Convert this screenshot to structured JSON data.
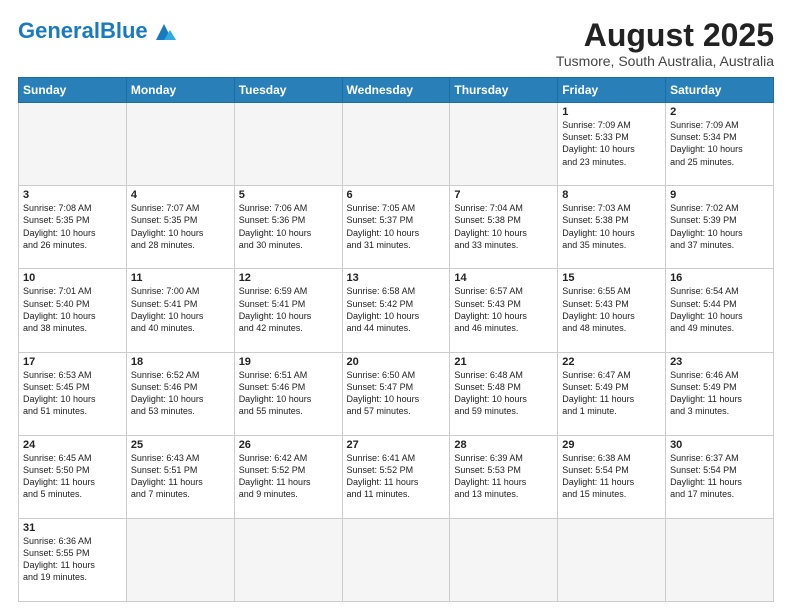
{
  "header": {
    "logo_general": "General",
    "logo_blue": "Blue",
    "month_year": "August 2025",
    "location": "Tusmore, South Australia, Australia"
  },
  "days_of_week": [
    "Sunday",
    "Monday",
    "Tuesday",
    "Wednesday",
    "Thursday",
    "Friday",
    "Saturday"
  ],
  "weeks": [
    [
      {
        "day": "",
        "info": ""
      },
      {
        "day": "",
        "info": ""
      },
      {
        "day": "",
        "info": ""
      },
      {
        "day": "",
        "info": ""
      },
      {
        "day": "",
        "info": ""
      },
      {
        "day": "1",
        "info": "Sunrise: 7:09 AM\nSunset: 5:33 PM\nDaylight: 10 hours\nand 23 minutes."
      },
      {
        "day": "2",
        "info": "Sunrise: 7:09 AM\nSunset: 5:34 PM\nDaylight: 10 hours\nand 25 minutes."
      }
    ],
    [
      {
        "day": "3",
        "info": "Sunrise: 7:08 AM\nSunset: 5:35 PM\nDaylight: 10 hours\nand 26 minutes."
      },
      {
        "day": "4",
        "info": "Sunrise: 7:07 AM\nSunset: 5:35 PM\nDaylight: 10 hours\nand 28 minutes."
      },
      {
        "day": "5",
        "info": "Sunrise: 7:06 AM\nSunset: 5:36 PM\nDaylight: 10 hours\nand 30 minutes."
      },
      {
        "day": "6",
        "info": "Sunrise: 7:05 AM\nSunset: 5:37 PM\nDaylight: 10 hours\nand 31 minutes."
      },
      {
        "day": "7",
        "info": "Sunrise: 7:04 AM\nSunset: 5:38 PM\nDaylight: 10 hours\nand 33 minutes."
      },
      {
        "day": "8",
        "info": "Sunrise: 7:03 AM\nSunset: 5:38 PM\nDaylight: 10 hours\nand 35 minutes."
      },
      {
        "day": "9",
        "info": "Sunrise: 7:02 AM\nSunset: 5:39 PM\nDaylight: 10 hours\nand 37 minutes."
      }
    ],
    [
      {
        "day": "10",
        "info": "Sunrise: 7:01 AM\nSunset: 5:40 PM\nDaylight: 10 hours\nand 38 minutes."
      },
      {
        "day": "11",
        "info": "Sunrise: 7:00 AM\nSunset: 5:41 PM\nDaylight: 10 hours\nand 40 minutes."
      },
      {
        "day": "12",
        "info": "Sunrise: 6:59 AM\nSunset: 5:41 PM\nDaylight: 10 hours\nand 42 minutes."
      },
      {
        "day": "13",
        "info": "Sunrise: 6:58 AM\nSunset: 5:42 PM\nDaylight: 10 hours\nand 44 minutes."
      },
      {
        "day": "14",
        "info": "Sunrise: 6:57 AM\nSunset: 5:43 PM\nDaylight: 10 hours\nand 46 minutes."
      },
      {
        "day": "15",
        "info": "Sunrise: 6:55 AM\nSunset: 5:43 PM\nDaylight: 10 hours\nand 48 minutes."
      },
      {
        "day": "16",
        "info": "Sunrise: 6:54 AM\nSunset: 5:44 PM\nDaylight: 10 hours\nand 49 minutes."
      }
    ],
    [
      {
        "day": "17",
        "info": "Sunrise: 6:53 AM\nSunset: 5:45 PM\nDaylight: 10 hours\nand 51 minutes."
      },
      {
        "day": "18",
        "info": "Sunrise: 6:52 AM\nSunset: 5:46 PM\nDaylight: 10 hours\nand 53 minutes."
      },
      {
        "day": "19",
        "info": "Sunrise: 6:51 AM\nSunset: 5:46 PM\nDaylight: 10 hours\nand 55 minutes."
      },
      {
        "day": "20",
        "info": "Sunrise: 6:50 AM\nSunset: 5:47 PM\nDaylight: 10 hours\nand 57 minutes."
      },
      {
        "day": "21",
        "info": "Sunrise: 6:48 AM\nSunset: 5:48 PM\nDaylight: 10 hours\nand 59 minutes."
      },
      {
        "day": "22",
        "info": "Sunrise: 6:47 AM\nSunset: 5:49 PM\nDaylight: 11 hours\nand 1 minute."
      },
      {
        "day": "23",
        "info": "Sunrise: 6:46 AM\nSunset: 5:49 PM\nDaylight: 11 hours\nand 3 minutes."
      }
    ],
    [
      {
        "day": "24",
        "info": "Sunrise: 6:45 AM\nSunset: 5:50 PM\nDaylight: 11 hours\nand 5 minutes."
      },
      {
        "day": "25",
        "info": "Sunrise: 6:43 AM\nSunset: 5:51 PM\nDaylight: 11 hours\nand 7 minutes."
      },
      {
        "day": "26",
        "info": "Sunrise: 6:42 AM\nSunset: 5:52 PM\nDaylight: 11 hours\nand 9 minutes."
      },
      {
        "day": "27",
        "info": "Sunrise: 6:41 AM\nSunset: 5:52 PM\nDaylight: 11 hours\nand 11 minutes."
      },
      {
        "day": "28",
        "info": "Sunrise: 6:39 AM\nSunset: 5:53 PM\nDaylight: 11 hours\nand 13 minutes."
      },
      {
        "day": "29",
        "info": "Sunrise: 6:38 AM\nSunset: 5:54 PM\nDaylight: 11 hours\nand 15 minutes."
      },
      {
        "day": "30",
        "info": "Sunrise: 6:37 AM\nSunset: 5:54 PM\nDaylight: 11 hours\nand 17 minutes."
      }
    ],
    [
      {
        "day": "31",
        "info": "Sunrise: 6:36 AM\nSunset: 5:55 PM\nDaylight: 11 hours\nand 19 minutes."
      },
      {
        "day": "",
        "info": ""
      },
      {
        "day": "",
        "info": ""
      },
      {
        "day": "",
        "info": ""
      },
      {
        "day": "",
        "info": ""
      },
      {
        "day": "",
        "info": ""
      },
      {
        "day": "",
        "info": ""
      }
    ]
  ]
}
